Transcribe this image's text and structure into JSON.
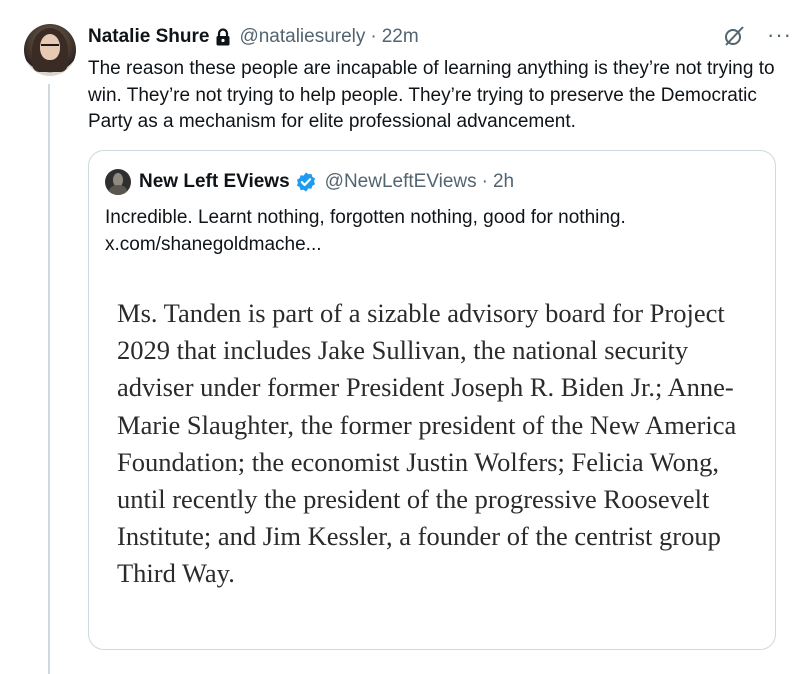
{
  "tweet": {
    "display_name": "Natalie Shure",
    "handle": "@nataliesurely",
    "separator": "·",
    "time": "22m",
    "text": "The reason these people are incapable of learning anything is they’re not trying to win. They’re not trying to help people. They’re trying to preserve the Democratic Party as a mechanism for elite professional advancement.",
    "icons": {
      "lock": "lock-icon",
      "grok": "grok-icon",
      "more": "more-icon",
      "more_glyph": "···"
    }
  },
  "quoted_tweet": {
    "display_name": "New Left EViews",
    "handle": "@NewLeftEViews",
    "separator": "·",
    "time": "2h",
    "text": "Incredible. Learnt nothing, forgotten nothing, good for nothing.",
    "link": "x.com/shanegoldmache...",
    "verified_color": "#1d9bf0",
    "image_text": "Ms. Tanden is part of a sizable advisory board for Project 2029 that includes Jake Sullivan, the national security adviser under former President Joseph R. Biden Jr.; Anne-Marie Slaughter, the former president of the New America Foundation; the economist Justin Wolfers; Felicia Wong, until recently the president of the progressive Roosevelt Institute; and Jim Kessler, a founder of the centrist group Third Way."
  }
}
